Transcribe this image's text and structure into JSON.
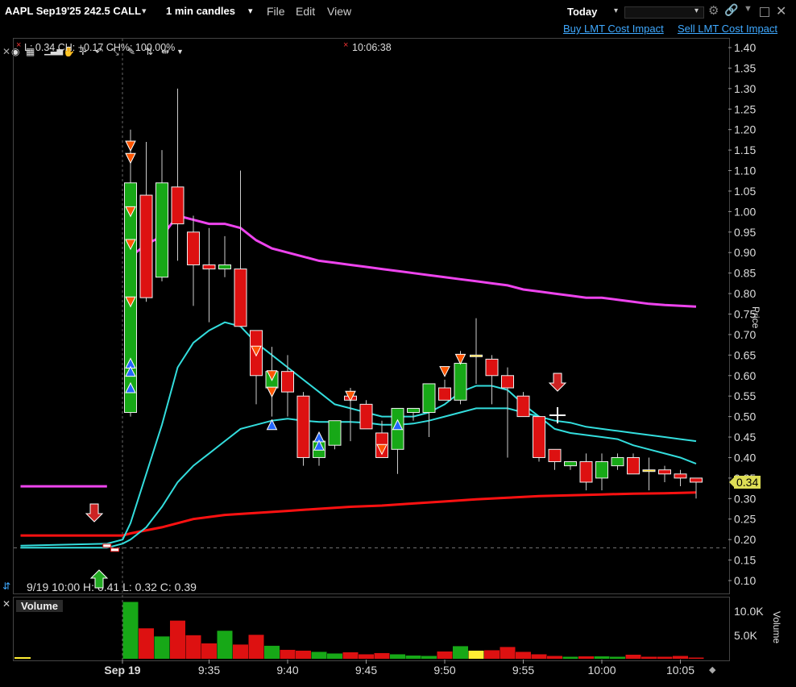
{
  "header": {
    "contract": "AAPL Sep19'25 242.5 CALL",
    "contract_dropdown": "▾",
    "interval": "1 min candles",
    "interval_dropdown": "▾",
    "menu": [
      "File",
      "Edit",
      "View"
    ],
    "period": "Today",
    "period_dropdown": "▾",
    "right_dropdown": "▾"
  },
  "links": {
    "buy": "Buy LMT Cost Impact",
    "sell": "Sell LMT Cost Impact"
  },
  "chart_header": {
    "last_info": "L: 0.34  CH: +0.17  CH%: 100.00%",
    "time": "10:06:38",
    "bar_info": "9/19 10:00  H: 0.41  L: 0.32  C: 0.39",
    "price_axis_title": "Price",
    "last_price_label": "0.34"
  },
  "volume_panel": {
    "title": "Volume",
    "axis_title": "Volume",
    "ticks": [
      "10.0K",
      "5.0K"
    ]
  },
  "colors": {
    "up": "#17a817",
    "down": "#dd1111",
    "ma_magenta": "#ee44ee",
    "ma_cyan": "#33dddd",
    "ma_red": "#ff1111",
    "link": "#3fa9ff",
    "last_price_bg": "#dddd55"
  },
  "chart_data": {
    "type": "candlestick",
    "ylim": [
      0.07,
      1.43
    ],
    "yticks": [
      "1.40",
      "1.35",
      "1.30",
      "1.25",
      "1.20",
      "1.15",
      "1.10",
      "1.05",
      "1.00",
      "0.95",
      "0.90",
      "0.85",
      "0.80",
      "0.75",
      "0.70",
      "0.65",
      "0.60",
      "0.55",
      "0.50",
      "0.45",
      "0.40",
      "0.35",
      "0.30",
      "0.25",
      "0.20",
      "0.15",
      "0.10"
    ],
    "xticks": [
      "Sep 19",
      "9:35",
      "9:40",
      "9:45",
      "9:50",
      "9:55",
      "10:00",
      "10:05"
    ],
    "xtick_minutes": [
      -1,
      5,
      10,
      15,
      20,
      25,
      30,
      35
    ],
    "premarket_close": 0.18,
    "candles": [
      {
        "m": 0,
        "o": 0.51,
        "h": 1.2,
        "l": 0.5,
        "c": 1.07
      },
      {
        "m": 1,
        "o": 1.04,
        "h": 1.17,
        "l": 0.78,
        "c": 0.79
      },
      {
        "m": 2,
        "o": 0.84,
        "h": 1.15,
        "l": 0.83,
        "c": 1.07
      },
      {
        "m": 3,
        "o": 1.06,
        "h": 1.3,
        "l": 0.88,
        "c": 0.97
      },
      {
        "m": 4,
        "o": 0.95,
        "h": 0.99,
        "l": 0.77,
        "c": 0.87
      },
      {
        "m": 5,
        "o": 0.87,
        "h": 0.96,
        "l": 0.73,
        "c": 0.86
      },
      {
        "m": 6,
        "o": 0.86,
        "h": 0.94,
        "l": 0.84,
        "c": 0.87
      },
      {
        "m": 7,
        "o": 0.86,
        "h": 1.1,
        "l": 0.73,
        "c": 0.72
      },
      {
        "m": 8,
        "o": 0.71,
        "h": 0.71,
        "l": 0.53,
        "c": 0.6
      },
      {
        "m": 9,
        "o": 0.57,
        "h": 0.67,
        "l": 0.5,
        "c": 0.61
      },
      {
        "m": 10,
        "o": 0.61,
        "h": 0.65,
        "l": 0.5,
        "c": 0.56
      },
      {
        "m": 11,
        "o": 0.55,
        "h": 0.56,
        "l": 0.38,
        "c": 0.4
      },
      {
        "m": 12,
        "o": 0.4,
        "h": 0.44,
        "l": 0.38,
        "c": 0.44
      },
      {
        "m": 13,
        "o": 0.43,
        "h": 0.49,
        "l": 0.42,
        "c": 0.49
      },
      {
        "m": 14,
        "o": 0.55,
        "h": 0.57,
        "l": 0.44,
        "c": 0.54
      },
      {
        "m": 15,
        "o": 0.53,
        "h": 0.54,
        "l": 0.47,
        "c": 0.47
      },
      {
        "m": 16,
        "o": 0.46,
        "h": 0.49,
        "l": 0.4,
        "c": 0.4
      },
      {
        "m": 17,
        "o": 0.42,
        "h": 0.52,
        "l": 0.36,
        "c": 0.52
      },
      {
        "m": 18,
        "o": 0.51,
        "h": 0.52,
        "l": 0.49,
        "c": 0.52
      },
      {
        "m": 19,
        "o": 0.51,
        "h": 0.58,
        "l": 0.45,
        "c": 0.58
      },
      {
        "m": 20,
        "o": 0.57,
        "h": 0.59,
        "l": 0.54,
        "c": 0.54
      },
      {
        "m": 21,
        "o": 0.54,
        "h": 0.66,
        "l": 0.53,
        "c": 0.63
      },
      {
        "m": 22,
        "o": 0.65,
        "h": 0.74,
        "l": 0.58,
        "c": 0.65
      },
      {
        "m": 23,
        "o": 0.64,
        "h": 0.65,
        "l": 0.53,
        "c": 0.6
      },
      {
        "m": 24,
        "o": 0.6,
        "h": 0.62,
        "l": 0.4,
        "c": 0.57
      },
      {
        "m": 25,
        "o": 0.55,
        "h": 0.56,
        "l": 0.5,
        "c": 0.5
      },
      {
        "m": 26,
        "o": 0.5,
        "h": 0.5,
        "l": 0.39,
        "c": 0.4
      },
      {
        "m": 27,
        "o": 0.42,
        "h": 0.42,
        "l": 0.37,
        "c": 0.39
      },
      {
        "m": 28,
        "o": 0.38,
        "h": 0.39,
        "l": 0.37,
        "c": 0.39
      },
      {
        "m": 29,
        "o": 0.39,
        "h": 0.41,
        "l": 0.32,
        "c": 0.34
      },
      {
        "m": 30,
        "o": 0.35,
        "h": 0.41,
        "l": 0.32,
        "c": 0.39
      },
      {
        "m": 31,
        "o": 0.38,
        "h": 0.41,
        "l": 0.37,
        "c": 0.4
      },
      {
        "m": 32,
        "o": 0.4,
        "h": 0.41,
        "l": 0.36,
        "c": 0.36
      },
      {
        "m": 33,
        "o": 0.37,
        "h": 0.4,
        "l": 0.32,
        "c": 0.37
      },
      {
        "m": 34,
        "o": 0.37,
        "h": 0.38,
        "l": 0.34,
        "c": 0.36
      },
      {
        "m": 35,
        "o": 0.36,
        "h": 0.37,
        "l": 0.33,
        "c": 0.35
      },
      {
        "m": 36,
        "o": 0.35,
        "h": 0.35,
        "l": 0.3,
        "c": 0.34
      }
    ],
    "volume_ylim": [
      0,
      14500
    ],
    "volume": [
      {
        "m": 0,
        "v": 14000,
        "up": true
      },
      {
        "m": 1,
        "v": 7500,
        "up": false
      },
      {
        "m": 2,
        "v": 5500,
        "up": true
      },
      {
        "m": 3,
        "v": 9400,
        "up": false
      },
      {
        "m": 4,
        "v": 5800,
        "up": false
      },
      {
        "m": 5,
        "v": 3800,
        "up": false
      },
      {
        "m": 6,
        "v": 6900,
        "up": true
      },
      {
        "m": 7,
        "v": 3500,
        "up": false
      },
      {
        "m": 8,
        "v": 5900,
        "up": false
      },
      {
        "m": 9,
        "v": 3200,
        "up": true
      },
      {
        "m": 10,
        "v": 2200,
        "up": false
      },
      {
        "m": 11,
        "v": 2000,
        "up": false
      },
      {
        "m": 12,
        "v": 1700,
        "up": true
      },
      {
        "m": 13,
        "v": 1300,
        "up": true
      },
      {
        "m": 14,
        "v": 1600,
        "up": false
      },
      {
        "m": 15,
        "v": 1100,
        "up": false
      },
      {
        "m": 16,
        "v": 1400,
        "up": false
      },
      {
        "m": 17,
        "v": 1100,
        "up": true
      },
      {
        "m": 18,
        "v": 800,
        "up": true
      },
      {
        "m": 19,
        "v": 700,
        "up": true
      },
      {
        "m": 20,
        "v": 1800,
        "up": false
      },
      {
        "m": 21,
        "v": 3100,
        "up": true
      },
      {
        "m": 22,
        "v": 2000,
        "up": null
      },
      {
        "m": 23,
        "v": 2100,
        "up": false
      },
      {
        "m": 24,
        "v": 2900,
        "up": false
      },
      {
        "m": 25,
        "v": 1700,
        "up": false
      },
      {
        "m": 26,
        "v": 1100,
        "up": false
      },
      {
        "m": 27,
        "v": 700,
        "up": false
      },
      {
        "m": 28,
        "v": 500,
        "up": true
      },
      {
        "m": 29,
        "v": 600,
        "up": false
      },
      {
        "m": 30,
        "v": 600,
        "up": true
      },
      {
        "m": 31,
        "v": 500,
        "up": true
      },
      {
        "m": 32,
        "v": 1000,
        "up": false
      },
      {
        "m": 33,
        "v": 500,
        "up": false
      },
      {
        "m": 34,
        "v": 500,
        "up": false
      },
      {
        "m": 35,
        "v": 700,
        "up": false
      },
      {
        "m": 36,
        "v": 300,
        "up": false
      }
    ],
    "ma_magenta": [
      [
        0,
        0.89
      ],
      [
        1,
        0.92
      ],
      [
        2,
        0.94
      ],
      [
        3,
        0.99
      ],
      [
        4,
        0.98
      ],
      [
        5,
        0.97
      ],
      [
        6,
        0.97
      ],
      [
        7,
        0.96
      ],
      [
        8,
        0.93
      ],
      [
        9,
        0.91
      ],
      [
        10,
        0.9
      ],
      [
        11,
        0.89
      ],
      [
        12,
        0.88
      ],
      [
        13,
        0.875
      ],
      [
        14,
        0.87
      ],
      [
        15,
        0.865
      ],
      [
        16,
        0.86
      ],
      [
        17,
        0.855
      ],
      [
        18,
        0.85
      ],
      [
        19,
        0.845
      ],
      [
        20,
        0.84
      ],
      [
        21,
        0.835
      ],
      [
        22,
        0.83
      ],
      [
        23,
        0.825
      ],
      [
        24,
        0.82
      ],
      [
        25,
        0.81
      ],
      [
        26,
        0.805
      ],
      [
        27,
        0.8
      ],
      [
        28,
        0.795
      ],
      [
        29,
        0.79
      ],
      [
        30,
        0.79
      ],
      [
        31,
        0.785
      ],
      [
        32,
        0.78
      ],
      [
        33,
        0.775
      ],
      [
        34,
        0.772
      ],
      [
        35,
        0.77
      ],
      [
        36,
        0.768
      ]
    ],
    "ma_magenta_pre": [
      [
        -7,
        0.33
      ],
      [
        -1.5,
        0.33
      ]
    ],
    "ma_cyan_fast": [
      [
        -7,
        0.185
      ],
      [
        -1.5,
        0.19
      ],
      [
        -0.5,
        0.2
      ],
      [
        0,
        0.24
      ],
      [
        1,
        0.36
      ],
      [
        2,
        0.48
      ],
      [
        3,
        0.62
      ],
      [
        4,
        0.68
      ],
      [
        5,
        0.71
      ],
      [
        6,
        0.73
      ],
      [
        7,
        0.72
      ],
      [
        8,
        0.68
      ],
      [
        9,
        0.65
      ],
      [
        10,
        0.62
      ],
      [
        11,
        0.59
      ],
      [
        12,
        0.56
      ],
      [
        13,
        0.53
      ],
      [
        14,
        0.52
      ],
      [
        15,
        0.51
      ],
      [
        16,
        0.5
      ],
      [
        17,
        0.5
      ],
      [
        18,
        0.5
      ],
      [
        19,
        0.51
      ],
      [
        20,
        0.53
      ],
      [
        21,
        0.56
      ],
      [
        22,
        0.575
      ],
      [
        23,
        0.575
      ],
      [
        24,
        0.565
      ],
      [
        25,
        0.53
      ],
      [
        26,
        0.5
      ],
      [
        27,
        0.47
      ],
      [
        28,
        0.46
      ],
      [
        29,
        0.455
      ],
      [
        30,
        0.45
      ],
      [
        31,
        0.445
      ],
      [
        32,
        0.43
      ],
      [
        33,
        0.42
      ],
      [
        34,
        0.41
      ],
      [
        35,
        0.4
      ],
      [
        36,
        0.385
      ]
    ],
    "ma_cyan_slow": [
      [
        -7,
        0.18
      ],
      [
        -1.5,
        0.18
      ],
      [
        -0.5,
        0.19
      ],
      [
        0,
        0.2
      ],
      [
        1,
        0.23
      ],
      [
        2,
        0.28
      ],
      [
        3,
        0.34
      ],
      [
        4,
        0.38
      ],
      [
        5,
        0.41
      ],
      [
        6,
        0.44
      ],
      [
        7,
        0.47
      ],
      [
        8,
        0.48
      ],
      [
        9,
        0.49
      ],
      [
        10,
        0.495
      ],
      [
        11,
        0.49
      ],
      [
        12,
        0.487
      ],
      [
        13,
        0.487
      ],
      [
        14,
        0.487
      ],
      [
        15,
        0.485
      ],
      [
        16,
        0.48
      ],
      [
        17,
        0.48
      ],
      [
        18,
        0.483
      ],
      [
        19,
        0.49
      ],
      [
        20,
        0.5
      ],
      [
        21,
        0.51
      ],
      [
        22,
        0.52
      ],
      [
        23,
        0.52
      ],
      [
        24,
        0.52
      ],
      [
        25,
        0.51
      ],
      [
        26,
        0.5
      ],
      [
        27,
        0.49
      ],
      [
        28,
        0.485
      ],
      [
        29,
        0.475
      ],
      [
        30,
        0.47
      ],
      [
        31,
        0.465
      ],
      [
        32,
        0.46
      ],
      [
        33,
        0.455
      ],
      [
        34,
        0.45
      ],
      [
        35,
        0.445
      ],
      [
        36,
        0.44
      ]
    ],
    "ma_red": [
      [
        -7,
        0.21
      ],
      [
        -1.5,
        0.21
      ],
      [
        -0.5,
        0.21
      ],
      [
        0,
        0.215
      ],
      [
        2,
        0.23
      ],
      [
        4,
        0.25
      ],
      [
        6,
        0.26
      ],
      [
        8,
        0.265
      ],
      [
        10,
        0.27
      ],
      [
        12,
        0.275
      ],
      [
        14,
        0.28
      ],
      [
        16,
        0.283
      ],
      [
        18,
        0.288
      ],
      [
        20,
        0.293
      ],
      [
        22,
        0.298
      ],
      [
        24,
        0.302
      ],
      [
        26,
        0.306
      ],
      [
        28,
        0.308
      ],
      [
        30,
        0.31
      ],
      [
        32,
        0.312
      ],
      [
        34,
        0.313
      ],
      [
        36,
        0.315
      ]
    ],
    "markers_down": [
      [
        0,
        1.16
      ],
      [
        0,
        1.13
      ],
      [
        0,
        1.0
      ],
      [
        0,
        0.92
      ],
      [
        0,
        0.78
      ],
      [
        8,
        0.66
      ],
      [
        9,
        0.6
      ],
      [
        9,
        0.56
      ],
      [
        14,
        0.55
      ],
      [
        16,
        0.42
      ],
      [
        20,
        0.61
      ],
      [
        21,
        0.64
      ]
    ],
    "markers_up": [
      [
        0,
        0.63
      ],
      [
        0,
        0.61
      ],
      [
        0,
        0.57
      ],
      [
        9,
        0.48
      ],
      [
        12,
        0.45
      ],
      [
        12,
        0.43
      ],
      [
        17,
        0.48
      ]
    ],
    "pre_bars": [
      [
        -1.5,
        0.185
      ],
      [
        -1,
        0.175
      ]
    ]
  }
}
